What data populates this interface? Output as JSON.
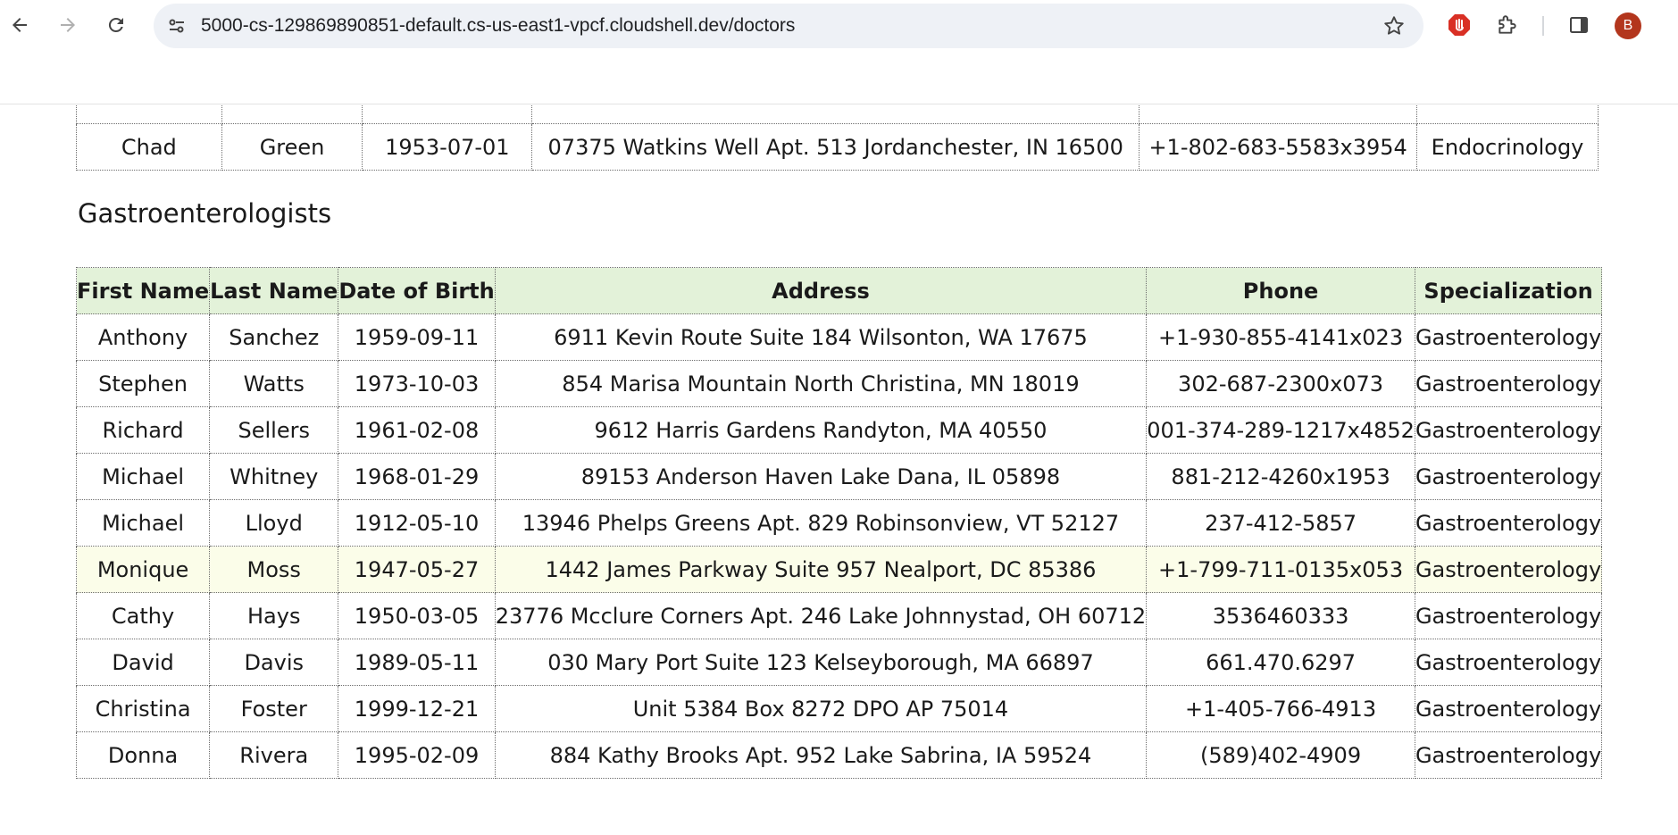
{
  "browser": {
    "url": "5000-cs-129869890851-default.cs-us-east1-vpcf.cloudshell.dev/doctors",
    "profile_initial": "B",
    "icons": [
      "back-icon",
      "forward-icon",
      "reload-icon",
      "site-info-icon",
      "bookmark-star-icon",
      "extension-shield-icon",
      "extensions-puzzle-icon",
      "side-panel-icon",
      "profile-avatar"
    ]
  },
  "previous_section": {
    "visible_row": {
      "first_name": "Chad",
      "last_name": "Green",
      "dob": "1953-07-01",
      "address": "07375 Watkins Well Apt. 513 Jordanchester, IN 16500",
      "phone": "+1-802-683-5583x3954",
      "specialization": "Endocrinology"
    }
  },
  "gastro": {
    "heading": "Gastroenterologists",
    "headers": {
      "first_name": "First Name",
      "last_name": "Last Name",
      "dob": "Date of Birth",
      "address": "Address",
      "phone": "Phone",
      "specialization": "Specialization"
    },
    "rows": [
      {
        "first_name": "Anthony",
        "last_name": "Sanchez",
        "dob": "1959-09-11",
        "address": "6911 Kevin Route Suite 184 Wilsonton, WA 17675",
        "phone": "+1-930-855-4141x023",
        "specialization": "Gastroenterology"
      },
      {
        "first_name": "Stephen",
        "last_name": "Watts",
        "dob": "1973-10-03",
        "address": "854 Marisa Mountain North Christina, MN 18019",
        "phone": "302-687-2300x073",
        "specialization": "Gastroenterology"
      },
      {
        "first_name": "Richard",
        "last_name": "Sellers",
        "dob": "1961-02-08",
        "address": "9612 Harris Gardens Randyton, MA 40550",
        "phone": "001-374-289-1217x4852",
        "specialization": "Gastroenterology"
      },
      {
        "first_name": "Michael",
        "last_name": "Whitney",
        "dob": "1968-01-29",
        "address": "89153 Anderson Haven Lake Dana, IL 05898",
        "phone": "881-212-4260x1953",
        "specialization": "Gastroenterology"
      },
      {
        "first_name": "Michael",
        "last_name": "Lloyd",
        "dob": "1912-05-10",
        "address": "13946 Phelps Greens Apt. 829 Robinsonview, VT 52127",
        "phone": "237-412-5857",
        "specialization": "Gastroenterology"
      },
      {
        "first_name": "Monique",
        "last_name": "Moss",
        "dob": "1947-05-27",
        "address": "1442 James Parkway Suite 957 Nealport, DC 85386",
        "phone": "+1-799-711-0135x053",
        "specialization": "Gastroenterology"
      },
      {
        "first_name": "Cathy",
        "last_name": "Hays",
        "dob": "1950-03-05",
        "address": "23776 Mcclure Corners Apt. 246 Lake Johnnystad, OH 60712",
        "phone": "3536460333",
        "specialization": "Gastroenterology"
      },
      {
        "first_name": "David",
        "last_name": "Davis",
        "dob": "1989-05-11",
        "address": "030 Mary Port Suite 123 Kelseyborough, MA 66897",
        "phone": "661.470.6297",
        "specialization": "Gastroenterology"
      },
      {
        "first_name": "Christina",
        "last_name": "Foster",
        "dob": "1999-12-21",
        "address": "Unit 5384 Box 8272 DPO AP 75014",
        "phone": "+1-405-766-4913",
        "specialization": "Gastroenterology"
      },
      {
        "first_name": "Donna",
        "last_name": "Rivera",
        "dob": "1995-02-09",
        "address": "884 Kathy Brooks Apt. 952 Lake Sabrina, IA 59524",
        "phone": "(589)402-4909",
        "specialization": "Gastroenterology"
      }
    ]
  },
  "colors": {
    "header_row_bg": "#e3f2d9",
    "hover_row_bg": "#fbfde9",
    "avatar_bg": "#b3361d",
    "extension_icon": "#d93025"
  }
}
